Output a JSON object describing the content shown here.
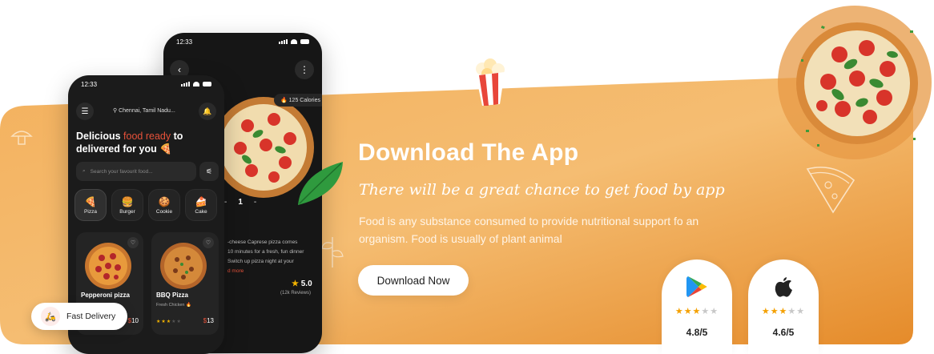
{
  "hero": {
    "title": "Download The App",
    "tagline": "There will be a great chance to get food by app",
    "description": "Food is any substance consumed to provide nutritional support fo an organism. Food is usually of plant animal",
    "download_button": "Download Now"
  },
  "stores": [
    {
      "icon": "google-play-icon",
      "stars": 3,
      "rating": "4.8/5"
    },
    {
      "icon": "apple-icon",
      "stars": 3,
      "rating": "4.6/5"
    }
  ],
  "badge": {
    "label": "Fast Delivery",
    "icon": "delivery-scooter-icon"
  },
  "phone_front": {
    "time": "12:33",
    "location": "Chennai, Tamil Nadu...",
    "headline_a": "Delicious ",
    "headline_highlight": "food ready",
    "headline_b": " to delivered for you",
    "search_placeholder": "Search your favourit food...",
    "categories": [
      {
        "label": "Pizza",
        "icon": "🍕"
      },
      {
        "label": "Burger",
        "icon": "🍔"
      },
      {
        "label": "Cookie",
        "icon": "🍪"
      },
      {
        "label": "Cake",
        "icon": "🍰"
      }
    ],
    "cards": [
      {
        "name": "Pepperoni pizza",
        "sub": "",
        "stars": 0,
        "price": "10"
      },
      {
        "name": "BBQ Pizza",
        "sub": "Fresh Chicken 🔥",
        "stars": 3,
        "price": "13"
      }
    ]
  },
  "phone_back": {
    "time": "12:33",
    "calories": "🔥 125 Calories",
    "quantity": "1",
    "qty_minus": "-",
    "qty_plus": "-",
    "desc_lines": [
      "-cheese Caprese pizza comes",
      "10 minutes for a fresh, fun dinner",
      "Switch up pizza night at your",
      "d more"
    ],
    "rating": "5.0",
    "reviews": "(12k Reviews)"
  },
  "colors": {
    "orange_light": "#f6c27c",
    "orange_dark": "#e58f2e",
    "accent_red": "#e8523a",
    "star": "#f4a000"
  }
}
